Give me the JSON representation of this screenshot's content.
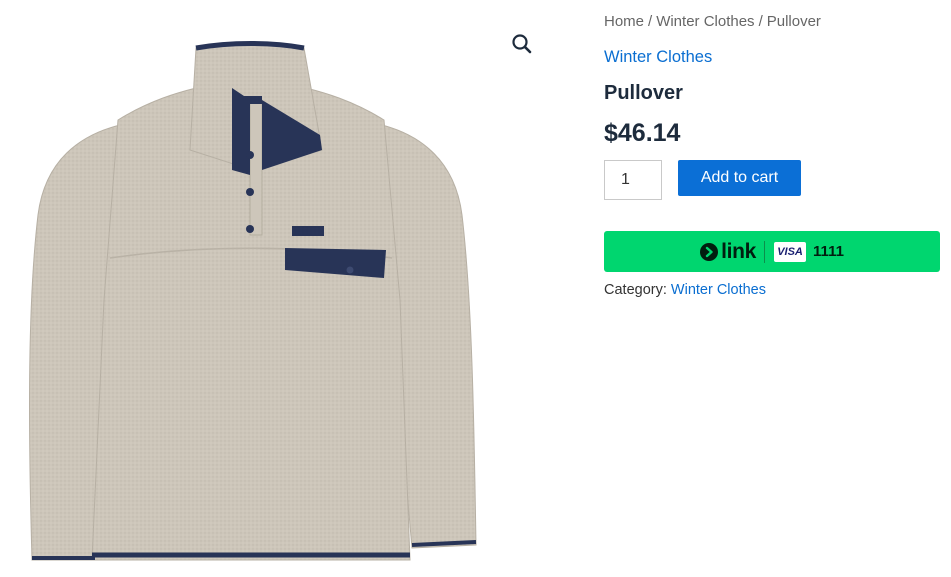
{
  "product_image": {
    "alt": "Pullover",
    "icon": "fleece-pullover-image"
  },
  "zoom": {
    "icon": "magnifier-icon"
  },
  "breadcrumb": {
    "home": "Home",
    "separator": "/",
    "category": "Winter Clothes",
    "current": "Pullover"
  },
  "category_link": "Winter Clothes",
  "product": {
    "title": "Pullover",
    "price": "$46.14"
  },
  "cart": {
    "quantity": "1",
    "add_label": "Add to cart"
  },
  "link_pay": {
    "word": "link",
    "card_brand": "VISA",
    "last4": "1111",
    "colors": {
      "background": "#00d66f",
      "text": "#011e0f"
    }
  },
  "meta": {
    "label": "Category:",
    "category": "Winter Clothes"
  },
  "colors": {
    "accent": "#0b6fd6",
    "link": "#0a6ed1",
    "heading": "#1d2b3c"
  }
}
